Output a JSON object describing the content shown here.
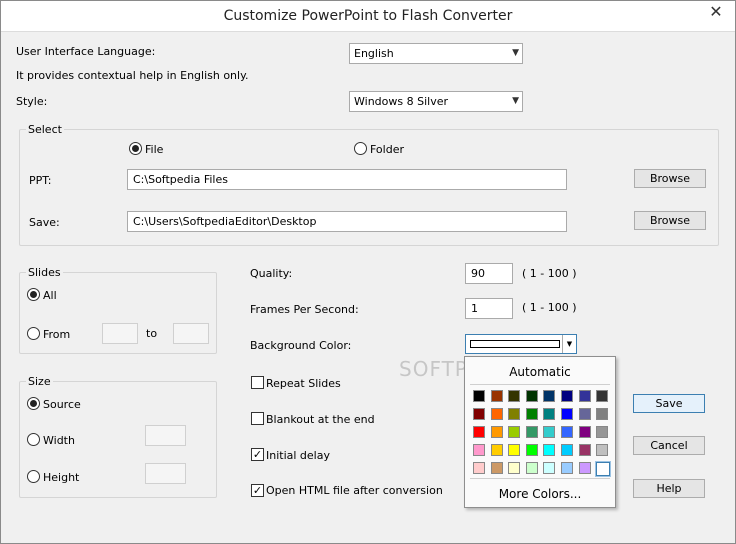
{
  "window": {
    "title": "Customize PowerPoint to Flash Converter",
    "close_glyph": "✕"
  },
  "language": {
    "label": "User Interface Language:",
    "value": "English",
    "help_text": "It provides contextual help in English only."
  },
  "style": {
    "label": "Style:",
    "value": "Windows 8 Silver"
  },
  "select_group": {
    "label": "Select",
    "file_label": "File",
    "folder_label": "Folder",
    "selected": "File",
    "ppt_label": "PPT:",
    "ppt_value": "C:\\Softpedia Files",
    "save_label": "Save:",
    "save_value": "C:\\Users\\SoftpediaEditor\\Desktop",
    "browse_label": "Browse"
  },
  "slides_group": {
    "label": "Slides",
    "all_label": "All",
    "from_label": "From",
    "to_label": "to",
    "selected": "All"
  },
  "size_group": {
    "label": "Size",
    "source_label": "Source",
    "width_label": "Width",
    "height_label": "Height",
    "selected": "Source"
  },
  "settings": {
    "quality_label": "Quality:",
    "quality_value": "90",
    "quality_range": "( 1 - 100 )",
    "fps_label": "Frames Per Second:",
    "fps_value": "1",
    "fps_range": "( 1 - 100 )",
    "bg_label": "Background Color:"
  },
  "options": {
    "repeat_slides": {
      "label": "Repeat Slides",
      "checked": false
    },
    "blankout": {
      "label": "Blankout at the end",
      "checked": false
    },
    "initial_delay": {
      "label": "Initial delay",
      "checked": true
    },
    "open_html": {
      "label": "Open HTML file after conversion",
      "checked": true
    },
    "check_glyph": "✓"
  },
  "buttons": {
    "save": "Save",
    "cancel": "Cancel",
    "help": "Help"
  },
  "color_popup": {
    "automatic_label": "Automatic",
    "more_colors_label": "More Colors...",
    "rows": [
      [
        "#000000",
        "#993300",
        "#333300",
        "#003300",
        "#003366",
        "#000080",
        "#333399",
        "#333333"
      ],
      [
        "#800000",
        "#ff6600",
        "#808000",
        "#008000",
        "#008080",
        "#0000ff",
        "#666699",
        "#808080"
      ],
      [
        "#ff0000",
        "#ff9900",
        "#99cc00",
        "#339966",
        "#33cccc",
        "#3366ff",
        "#800080",
        "#969696"
      ],
      [
        "#ff99cc",
        "#ffcc00",
        "#ffff00",
        "#00ff00",
        "#00ffff",
        "#00ccff",
        "#993366",
        "#c0c0c0"
      ],
      [
        "#ffcccc",
        "#cc9966",
        "#ffffcc",
        "#ccffcc",
        "#ccffff",
        "#99ccff",
        "#cc99ff",
        "#ffffff"
      ]
    ]
  },
  "watermark": "SOFTPEDIA"
}
